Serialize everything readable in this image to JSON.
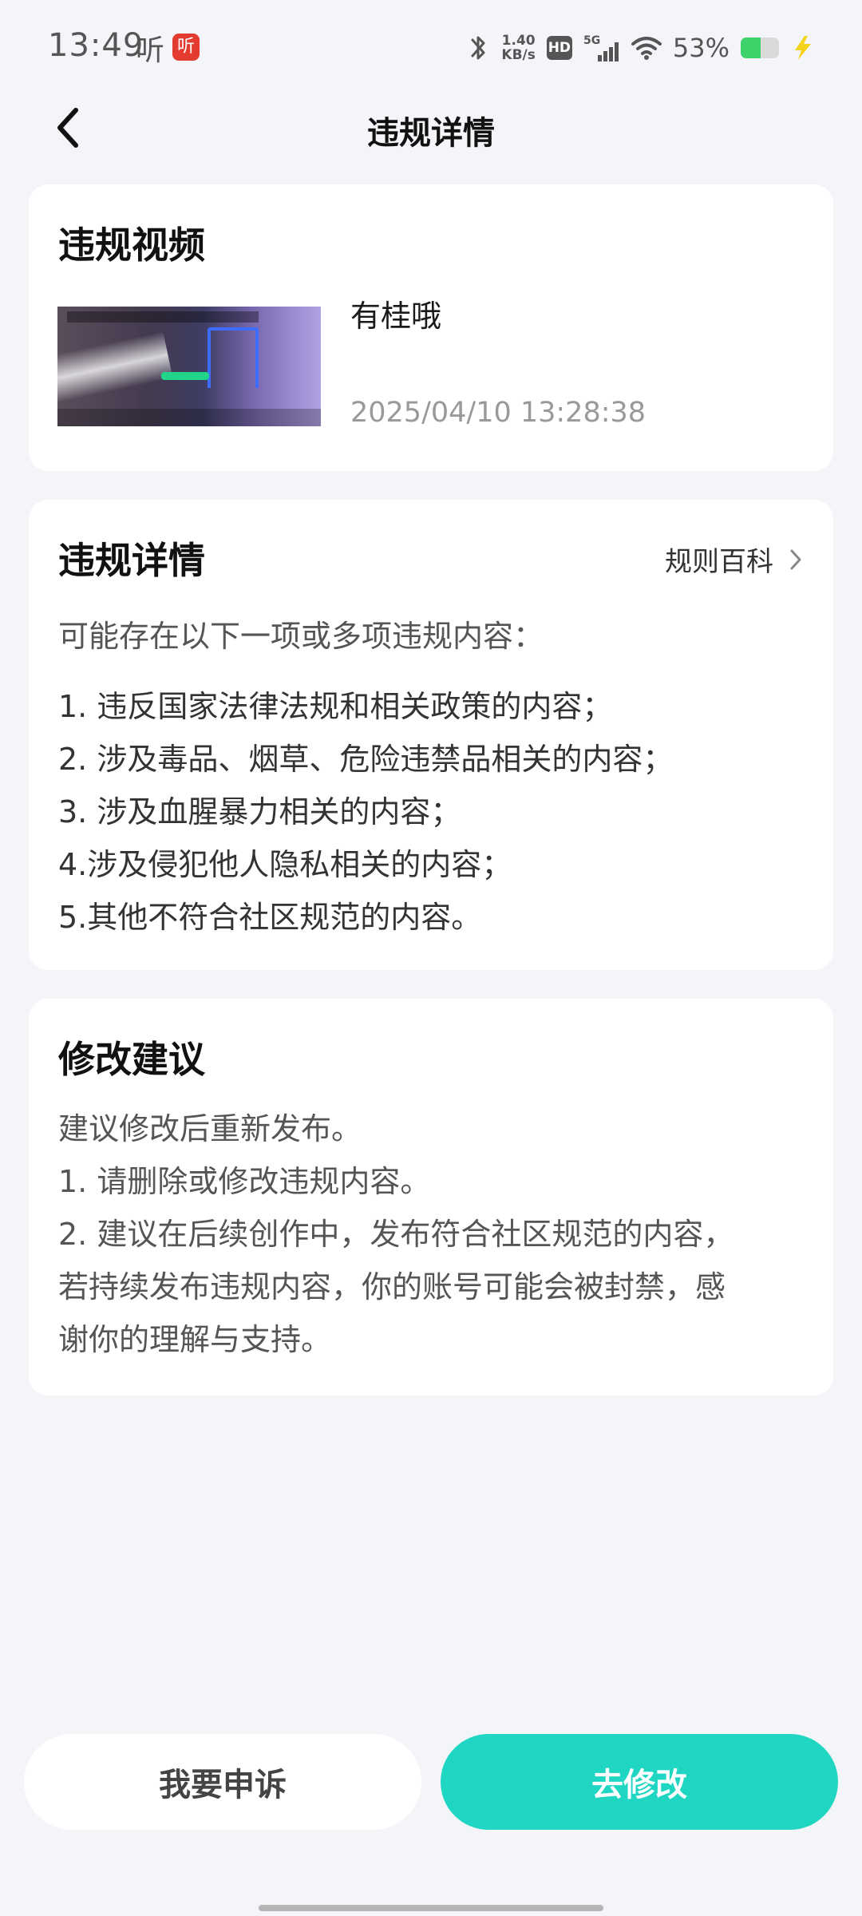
{
  "status_bar": {
    "time": "13:49",
    "ting_label": "听",
    "app_icon_label": "听",
    "speed_value": "1.40",
    "speed_unit": "KB/s",
    "hd_label": "HD",
    "network_label": "5G",
    "battery_text": "53%",
    "battery_level": 0.53,
    "icons": [
      "bluetooth-icon",
      "hd-icon",
      "signal-5g-icon",
      "wifi-icon",
      "battery-icon",
      "charging-icon"
    ]
  },
  "header": {
    "title": "违规详情"
  },
  "video_card": {
    "title": "违规视频",
    "video_name": "有桂哦",
    "timestamp": "2025/04/10 13:28:38"
  },
  "detail_card": {
    "title": "违规详情",
    "rules_link": "规则百科",
    "intro": "可能存在以下一项或多项违规内容：",
    "items": [
      "1. 违反国家法律法规和相关政策的内容；",
      "2. 涉及毒品、烟草、危险违禁品相关的内容；",
      "3. 涉及血腥暴力相关的内容；",
      "4.涉及侵犯他人隐私相关的内容；",
      "5.其他不符合社区规范的内容。"
    ]
  },
  "suggest_card": {
    "title": "修改建议",
    "lines": [
      "建议修改后重新发布。",
      "1. 请删除或修改违规内容。",
      "2. 建议在后续创作中，发布符合社区规范的内容，",
      "若持续发布违规内容，你的账号可能会被封禁，感",
      "谢你的理解与支持。"
    ]
  },
  "actions": {
    "appeal_label": "我要申诉",
    "modify_label": "去修改"
  },
  "colors": {
    "accent": "#1fd6c3",
    "background": "#f4f5f9",
    "card": "#ffffff",
    "secondary_text": "#999999"
  }
}
